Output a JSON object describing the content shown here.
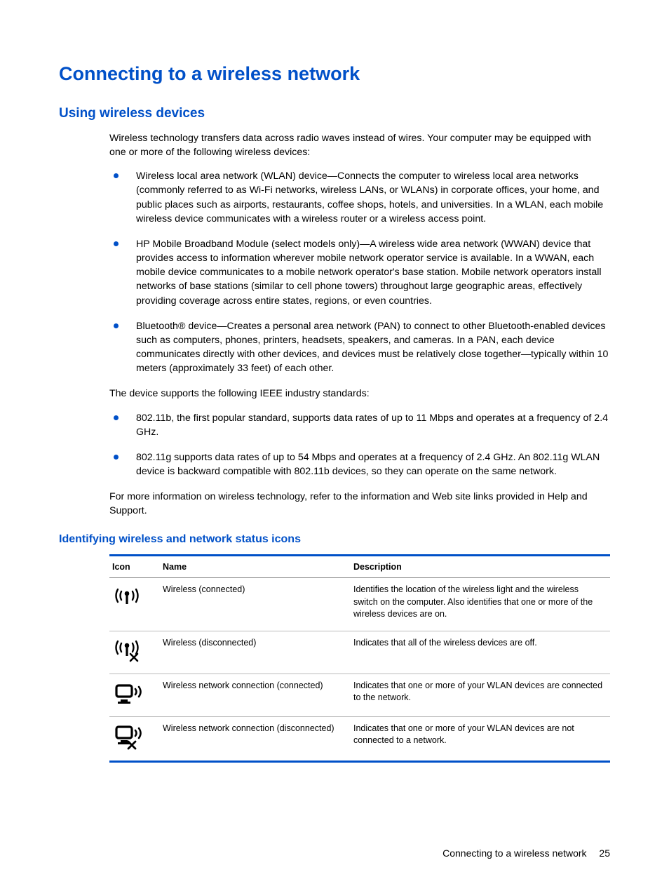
{
  "title": "Connecting to a wireless network",
  "section1": {
    "heading": "Using wireless devices",
    "intro": "Wireless technology transfers data across radio waves instead of wires. Your computer may be equipped with one or more of the following wireless devices:",
    "devices": [
      "Wireless local area network (WLAN) device—Connects the computer to wireless local area networks (commonly referred to as Wi-Fi networks, wireless LANs, or WLANs) in corporate offices, your home, and public places such as airports, restaurants, coffee shops, hotels, and universities. In a WLAN, each mobile wireless device communicates with a wireless router or a wireless access point.",
      "HP Mobile Broadband Module (select models only)—A wireless wide area network (WWAN) device that provides access to information wherever mobile network operator service is available. In a WWAN, each mobile device communicates to a mobile network operator's base station. Mobile network operators install networks of base stations (similar to cell phone towers) throughout large geographic areas, effectively providing coverage across entire states, regions, or even countries.",
      "Bluetooth® device—Creates a personal area network (PAN) to connect to other Bluetooth-enabled devices such as computers, phones, printers, headsets, speakers, and cameras. In a PAN, each device communicates directly with other devices, and devices must be relatively close together—typically within 10 meters (approximately 33 feet) of each other."
    ],
    "standards_intro": "The device  supports the following IEEE industry standards:",
    "standards": [
      "802.11b, the first popular standard, supports data rates of up to 11 Mbps and operates at a frequency of 2.4 GHz.",
      "802.11g supports data rates of up to 54 Mbps and operates at a frequency of 2.4 GHz. An 802.11g WLAN device is backward compatible with 802.11b devices, so they can operate on the same network."
    ],
    "moreinfo": "For more information on wireless technology, refer to the information and Web site links provided in Help and Support."
  },
  "section2": {
    "heading": "Identifying wireless and network status icons",
    "columns": {
      "icon": "Icon",
      "name": "Name",
      "desc": "Description"
    },
    "rows": [
      {
        "icon": "wireless-connected-icon",
        "name": "Wireless (connected)",
        "desc": "Identifies the location of the wireless light and the wireless switch on the computer. Also identifies that one or more of the wireless devices are on."
      },
      {
        "icon": "wireless-disconnected-icon",
        "name": "Wireless (disconnected)",
        "desc": "Indicates that all of the wireless devices are off."
      },
      {
        "icon": "wlan-connected-icon",
        "name": "Wireless network connection (connected)",
        "desc": "Indicates that one or more of your WLAN devices are connected to the network."
      },
      {
        "icon": "wlan-disconnected-icon",
        "name": "Wireless network connection (disconnected)",
        "desc": "Indicates that one or more of your WLAN devices are not connected to a network."
      }
    ]
  },
  "footer": {
    "title": "Connecting to a wireless network",
    "page": "25"
  }
}
